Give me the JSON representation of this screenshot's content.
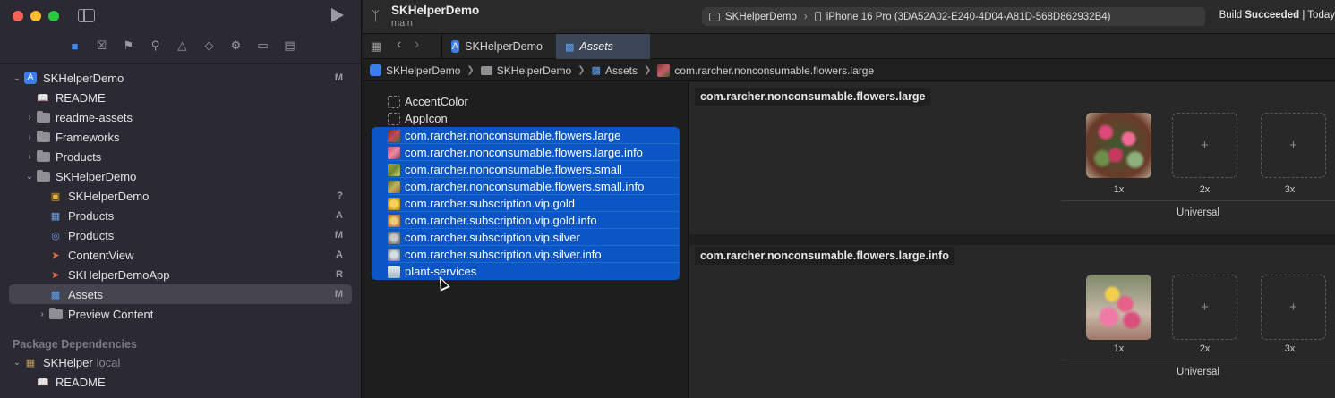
{
  "toolbar": {
    "project_title": "SKHelperDemo",
    "branch": "main",
    "scheme_name": "SKHelperDemo",
    "destination": "iPhone 16 Pro (3DA52A02-E240-4D04-A81D-568D862932B4)",
    "status_prefix": "Build",
    "status_bold": "Succeeded",
    "status_suffix": "| Today"
  },
  "tabs": [
    {
      "label": "SKHelperDemo",
      "active": false
    },
    {
      "label": "Assets",
      "active": true
    }
  ],
  "breadcrumb": [
    "SKHelperDemo",
    "SKHelperDemo",
    "Assets",
    "com.rarcher.nonconsumable.flowers.large"
  ],
  "navigator": {
    "items": [
      {
        "label": "SKHelperDemo",
        "badge": "M"
      },
      {
        "label": "README",
        "badge": ""
      },
      {
        "label": "readme-assets",
        "badge": ""
      },
      {
        "label": "Frameworks",
        "badge": ""
      },
      {
        "label": "Products",
        "badge": ""
      },
      {
        "label": "SKHelperDemo",
        "badge": ""
      },
      {
        "label": "SKHelperDemo",
        "badge": "?"
      },
      {
        "label": "Products",
        "badge": "A"
      },
      {
        "label": "Products",
        "badge": "M"
      },
      {
        "label": "ContentView",
        "badge": "A"
      },
      {
        "label": "SKHelperDemoApp",
        "badge": "R"
      },
      {
        "label": "Assets",
        "badge": "M"
      },
      {
        "label": "Preview Content",
        "badge": ""
      }
    ],
    "section_title": "Package Dependencies",
    "package_name": "SKHelper",
    "package_suffix": "local",
    "package_readme": "README"
  },
  "asset_list": [
    "AccentColor",
    "AppIcon",
    "com.rarcher.nonconsumable.flowers.large",
    "com.rarcher.nonconsumable.flowers.large.info",
    "com.rarcher.nonconsumable.flowers.small",
    "com.rarcher.nonconsumable.flowers.small.info",
    "com.rarcher.subscription.vip.gold",
    "com.rarcher.subscription.vip.gold.info",
    "com.rarcher.subscription.vip.silver",
    "com.rarcher.subscription.vip.silver.info",
    "plant-services"
  ],
  "detail": {
    "sets": [
      {
        "name": "com.rarcher.nonconsumable.flowers.large",
        "scales": [
          "1x",
          "2x",
          "3x"
        ],
        "group": "Universal"
      },
      {
        "name": "com.rarcher.nonconsumable.flowers.large.info",
        "scales": [
          "1x",
          "2x",
          "3x"
        ],
        "group": "Universal"
      }
    ],
    "add_glyph": "+"
  },
  "colors": {
    "selection": "#0a56c7",
    "accent": "#3b8cf7",
    "sidebar_bg": "#2b2a33"
  }
}
